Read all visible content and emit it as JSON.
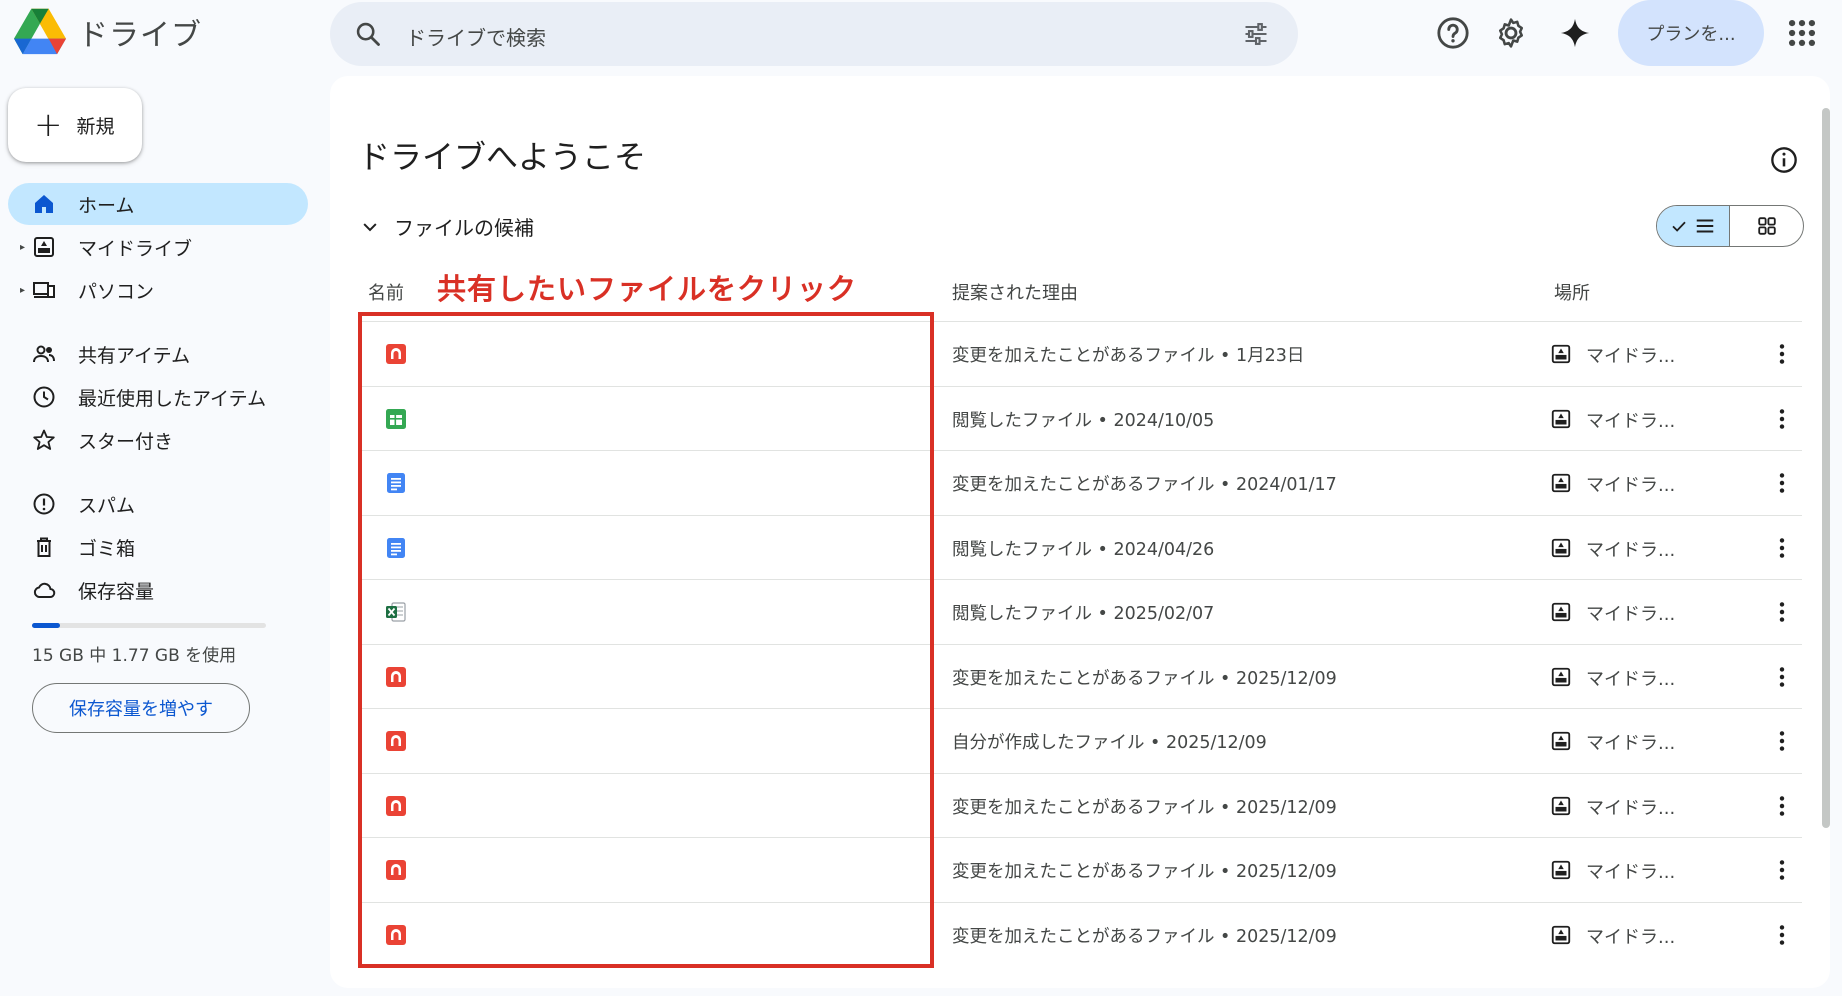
{
  "app": {
    "title": "ドライブ"
  },
  "search": {
    "placeholder": "ドライブで検索"
  },
  "header": {
    "plan_label": "プランを..."
  },
  "sidebar": {
    "new_label": "新規",
    "items": [
      {
        "label": "ホーム",
        "icon": "home-icon",
        "active": true
      },
      {
        "label": "マイドライブ",
        "icon": "my-drive-icon",
        "expandable": true
      },
      {
        "label": "パソコン",
        "icon": "computer-icon",
        "expandable": true
      },
      {
        "label": "共有アイテム",
        "icon": "people-icon"
      },
      {
        "label": "最近使用したアイテム",
        "icon": "clock-icon"
      },
      {
        "label": "スター付き",
        "icon": "star-icon"
      },
      {
        "label": "スパム",
        "icon": "spam-icon"
      },
      {
        "label": "ゴミ箱",
        "icon": "trash-icon"
      },
      {
        "label": "保存容量",
        "icon": "cloud-icon"
      }
    ],
    "storage": {
      "text": "15 GB 中 1.77 GB を使用",
      "used_fraction": 0.118,
      "button": "保存容量を増やす"
    }
  },
  "main": {
    "title": "ドライブへようこそ",
    "section": "ファイルの候補",
    "columns": {
      "name": "名前",
      "reason": "提案された理由",
      "location": "場所"
    },
    "annotation": "共有したいファイルをクリック",
    "files": [
      {
        "type": "pdf",
        "reason": "変更を加えたことがあるファイル • 1月23日",
        "location": "マイドラ..."
      },
      {
        "type": "sheets",
        "reason": "閲覧したファイル • 2024/10/05",
        "location": "マイドラ..."
      },
      {
        "type": "docs",
        "reason": "変更を加えたことがあるファイル • 2024/01/17",
        "location": "マイドラ..."
      },
      {
        "type": "docs",
        "reason": "閲覧したファイル • 2024/04/26",
        "location": "マイドラ..."
      },
      {
        "type": "excel",
        "reason": "閲覧したファイル • 2025/02/07",
        "location": "マイドラ..."
      },
      {
        "type": "pdf",
        "reason": "変更を加えたことがあるファイル • 2025/12/09",
        "location": "マイドラ..."
      },
      {
        "type": "pdf",
        "reason": "自分が作成したファイル • 2025/12/09",
        "location": "マイドラ..."
      },
      {
        "type": "pdf",
        "reason": "変更を加えたことがあるファイル • 2025/12/09",
        "location": "マイドラ..."
      },
      {
        "type": "pdf",
        "reason": "変更を加えたことがあるファイル • 2025/12/09",
        "location": "マイドラ..."
      },
      {
        "type": "pdf",
        "reason": "変更を加えたことがあるファイル • 2025/12/09",
        "location": "マイドラ..."
      }
    ]
  },
  "colors": {
    "accent": "#0b57d0",
    "active_bg": "#c2e7ff",
    "annotation": "#d93025",
    "pdf": "#ea4335",
    "sheets": "#34a853",
    "docs": "#4285f4",
    "excel": "#1d6f42"
  }
}
